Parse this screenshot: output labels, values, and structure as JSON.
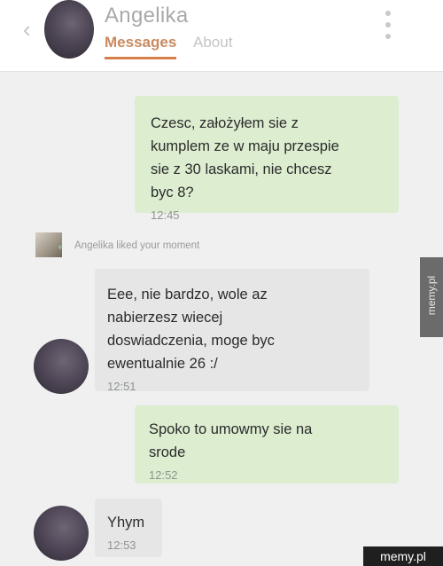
{
  "header": {
    "contact_name": "Angelika",
    "tabs": [
      {
        "label": "Messages",
        "active": true
      },
      {
        "label": "About",
        "active": false
      }
    ],
    "back_icon": "chevron-left-icon",
    "menu_icon": "more-vertical-icon"
  },
  "messages": [
    {
      "direction": "sent",
      "text": "Czesc, założyłem sie z\nkumplem ze w maju przespie\nsie z 30 laskami, nie chcesz\nbyc 8?",
      "time": "12:45"
    },
    {
      "direction": "received",
      "text": "Eee, nie bardzo,  wole az\nnabierzesz wiecej\ndoswiadczenia, moge byc\newentualnie 26 :/",
      "time": "12:51"
    },
    {
      "direction": "sent",
      "text": "Spoko to umowmy sie na\nsrode",
      "time": "12:52"
    },
    {
      "direction": "received",
      "text": "Yhym",
      "time": "12:53"
    }
  ],
  "activity": {
    "text": "Angelika liked your moment",
    "icon": "heart-icon"
  },
  "watermark": {
    "side": "memy.pl",
    "bottom": "memy.pl"
  },
  "colors": {
    "sent_bubble": "#dcedd0",
    "received_bubble": "#e6e6e6",
    "accent": "#d77f4a"
  }
}
